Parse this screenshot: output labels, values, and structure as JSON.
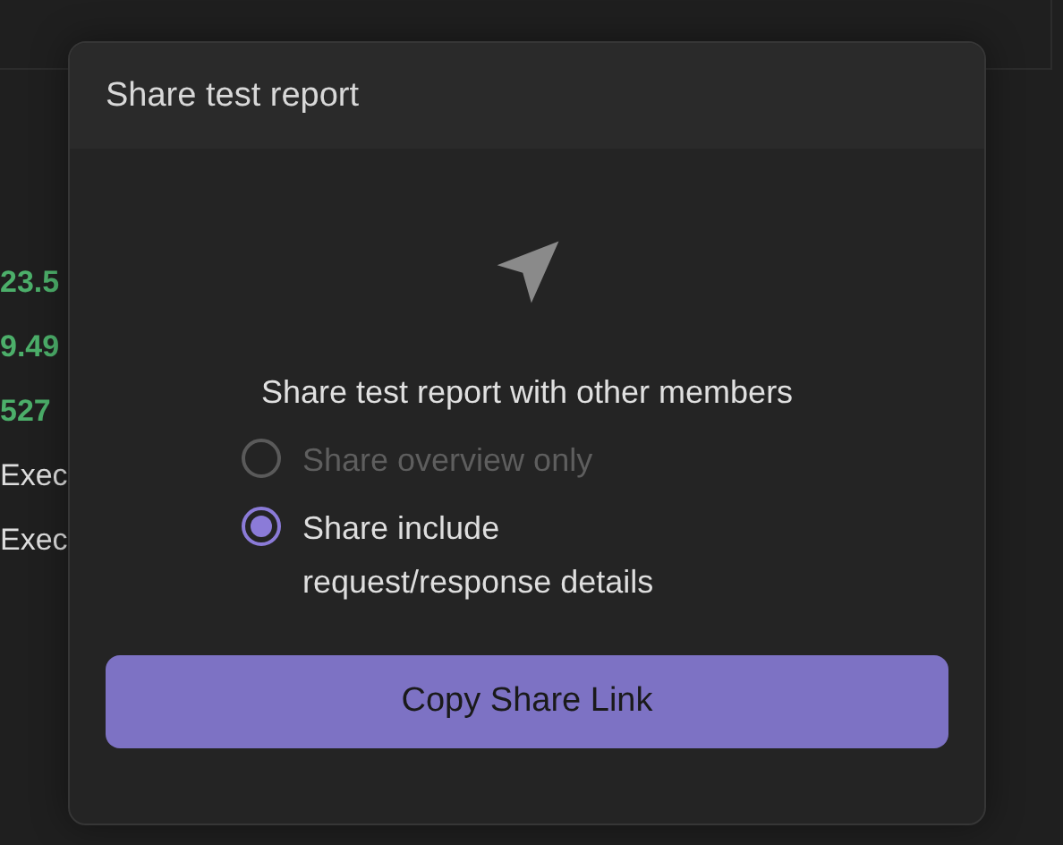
{
  "background_values": [
    {
      "text": "23.5",
      "kind": "metric"
    },
    {
      "text": "9.49",
      "kind": "metric"
    },
    {
      "text": "527",
      "kind": "metric"
    },
    {
      "text": "Exec",
      "kind": "label"
    },
    {
      "text": "Exec",
      "kind": "label"
    }
  ],
  "dialog": {
    "title": "Share test report",
    "heading": "Share test report with other members",
    "options": [
      {
        "label": "Share overview only",
        "selected": false,
        "disabled": true
      },
      {
        "label": "Share include request/response details",
        "selected": true,
        "disabled": false
      }
    ],
    "button": "Copy Share Link"
  }
}
